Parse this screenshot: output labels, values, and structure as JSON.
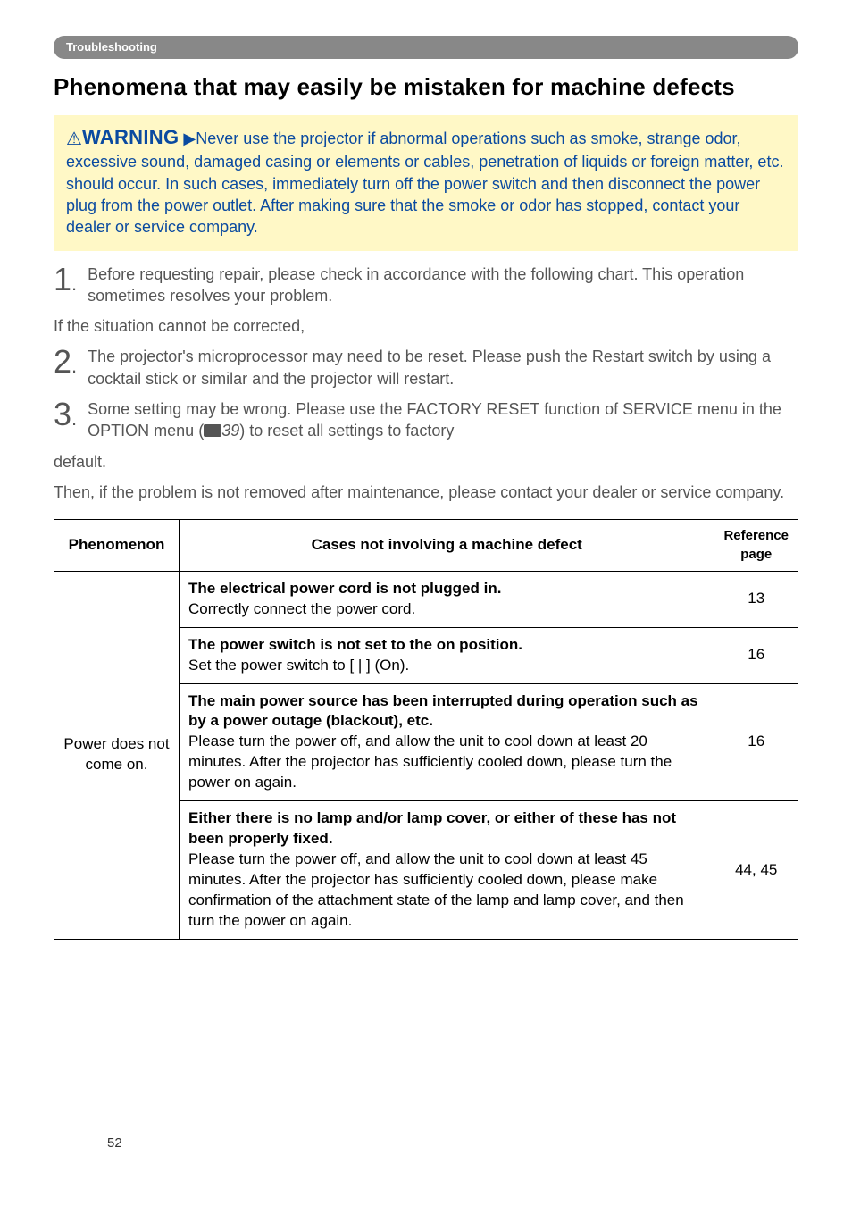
{
  "section_label": "Troubleshooting",
  "heading": "Phenomena that may easily be mistaken for machine defects",
  "warning": {
    "label": "WARNING",
    "body": "Never use the projector if abnormal operations such as smoke, strange odor, excessive sound, damaged casing or elements or cables, penetration of liquids or foreign matter, etc. should occur. In such cases, immediately turn off the power switch and then disconnect the power plug from the power outlet. After making sure that the smoke or odor has stopped, contact your dealer or service company."
  },
  "step1": {
    "num": "1",
    "text": "Before requesting repair, please check in accordance with the following chart. This operation sometimes resolves your problem."
  },
  "after1": "If the situation cannot be corrected,",
  "step2": {
    "num": "2",
    "text": "The projector's microprocessor may need to be reset. Please push the Restart switch by using a cocktail stick or similar and the projector will restart."
  },
  "step3": {
    "num": "3",
    "pre": "Some setting may be wrong. Please use the FACTORY RESET function of SERVICE menu in the OPTION menu (",
    "ref": "39",
    "post": ") to reset all settings to factory"
  },
  "after3a": "default.",
  "after3b": "Then, if the problem is not removed after maintenance, please contact your dealer or service company.",
  "table": {
    "headers": {
      "phenomenon": "Phenomenon",
      "cases": "Cases not involving a machine defect",
      "ref": "Reference page"
    },
    "phenomenon_label": "Power does not come on.",
    "rows": [
      {
        "bold": "The electrical power cord is not plugged in.",
        "rest": "Correctly connect the power cord.",
        "ref": "13"
      },
      {
        "bold": "The power switch is not set to the on position.",
        "rest": "Set the power switch to [ | ] (On).",
        "ref": "16"
      },
      {
        "bold": "The main power source has been interrupted during operation such as by a power outage (blackout), etc.",
        "rest": "Please turn the power off, and allow the unit to cool down at least 20 minutes. After the projector has sufficiently cooled down, please turn the power on again.",
        "ref": "16"
      },
      {
        "bold": "Either there is no lamp and/or lamp cover, or either of these has not been properly fixed.",
        "rest": "Please turn the power off, and allow the unit to cool down at least 45 minutes. After the projector has sufficiently cooled down, please make confirmation of the attachment state of the lamp and lamp cover, and then turn the power on again.",
        "ref": "44, 45"
      }
    ]
  },
  "page_number": "52"
}
